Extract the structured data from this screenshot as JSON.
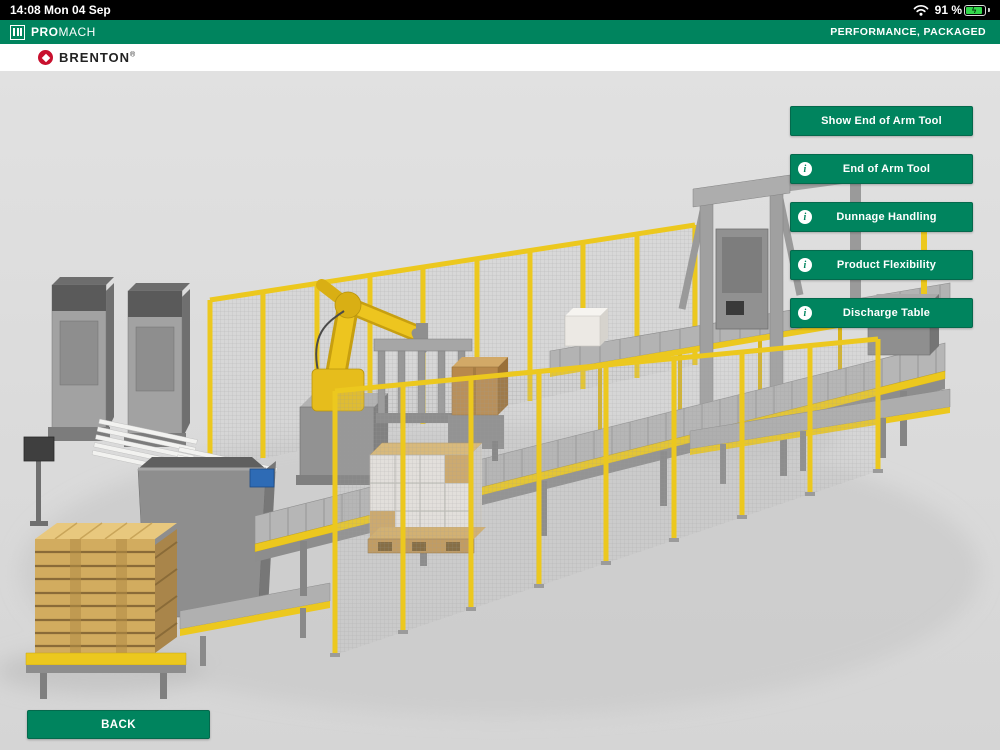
{
  "colors": {
    "accent_green": "#00845E",
    "accent_green_dark": "#04694C",
    "brenton_red": "#C8102E",
    "floor_gray": "#DCDCDC",
    "fence_yellow": "#ECC81E",
    "robot_yellow": "#EDC51F"
  },
  "status_bar": {
    "time": "14:08 Mon 04 Sep",
    "battery_percent": "91 %"
  },
  "header": {
    "brand_pro": "PRO",
    "brand_mach": "MACH",
    "tagline": "PERFORMANCE, PACKAGED"
  },
  "subheader": {
    "brand": "BRENTON",
    "trademark": "®"
  },
  "sidebar_buttons": [
    {
      "label": "Show End of Arm Tool",
      "has_info": false
    },
    {
      "label": "End of Arm Tool",
      "has_info": true
    },
    {
      "label": "Dunnage Handling",
      "has_info": true
    },
    {
      "label": "Product Flexibility",
      "has_info": true
    },
    {
      "label": "Discharge Table",
      "has_info": true
    }
  ],
  "back_button": {
    "label": "BACK"
  },
  "info_icon_glyph": "i"
}
